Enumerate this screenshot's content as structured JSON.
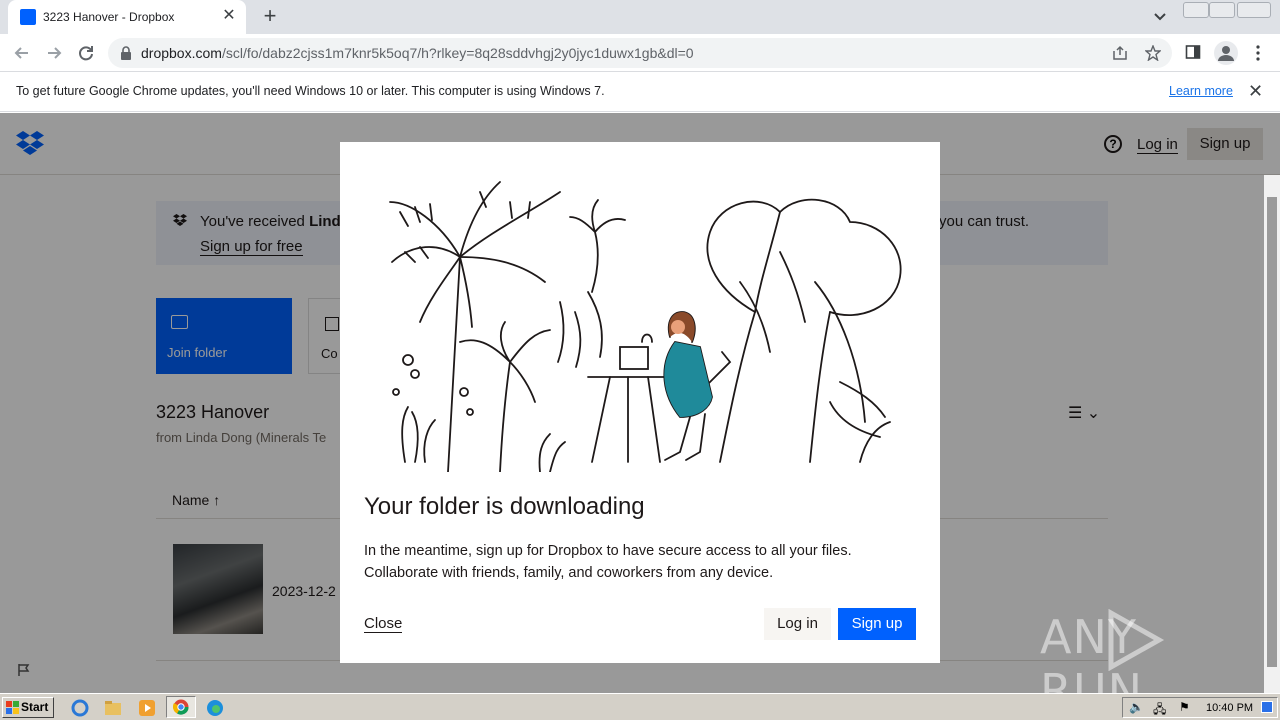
{
  "browser": {
    "tab_title": "3223 Hanover - Dropbox",
    "url_host": "dropbox.com",
    "url_path": "/scl/fo/dabz2cjss1m7knr5k5oq7/h?rlkey=8q28sddvhgj2y0jyc1duwx1gb&dl=0",
    "infobar_message": "To get future Google Chrome updates, you'll need Windows 10 or later. This computer is using Windows 7.",
    "infobar_link": "Learn more"
  },
  "header": {
    "login_label": "Log in",
    "signup_label": "Sign up"
  },
  "banner": {
    "text_prefix": "You've received ",
    "text_bold": "Linda",
    "text_suffix": "you can trust.",
    "signup_free": "Sign up for free"
  },
  "actions": {
    "join_folder": "Join folder",
    "copy": "Co"
  },
  "folder": {
    "name": "3223 Hanover",
    "from": "from Linda Dong (Minerals Te"
  },
  "table": {
    "column_name": "Name",
    "sort_arrow": "↑",
    "rows": [
      {
        "date": "2023-12-2"
      }
    ]
  },
  "modal": {
    "title": "Your folder is downloading",
    "body_line1": "In the meantime, sign up for Dropbox to have secure access to all your files.",
    "body_line2": "Collaborate with friends, family, and coworkers from any device.",
    "close_label": "Close",
    "login_label": "Log in",
    "signup_label": "Sign up"
  },
  "watermark": {
    "left": "ANY",
    "right": "RUN"
  },
  "taskbar": {
    "start_label": "Start",
    "clock": "10:40 PM"
  },
  "colors": {
    "dropbox_blue": "#0061fe",
    "overlay": "rgba(0,0,0,0.4)"
  }
}
